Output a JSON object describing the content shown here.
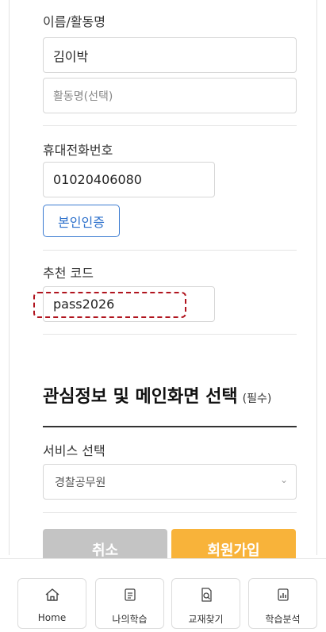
{
  "name_section": {
    "label": "이름/활동명",
    "name_value": "김이박",
    "nickname_placeholder": "활동명(선택)"
  },
  "phone_section": {
    "label": "휴대전화번호",
    "phone_value": "01020406080",
    "verify_label": "본인인증"
  },
  "referral_section": {
    "label": "추천 코드",
    "code_value": "pass2026"
  },
  "interest_section": {
    "title": "관심정보 및 메인화면 선택",
    "required": "(필수)",
    "service_label": "서비스 선택",
    "service_selected": "경찰공무원"
  },
  "actions": {
    "cancel_label": "취소",
    "join_label": "회원가입"
  },
  "tabbar": {
    "items": [
      {
        "label": "Home",
        "icon": "home-icon"
      },
      {
        "label": "나의학습",
        "icon": "my-study-icon"
      },
      {
        "label": "교재찾기",
        "icon": "book-search-icon"
      },
      {
        "label": "학습분석",
        "icon": "analysis-icon"
      }
    ]
  },
  "colors": {
    "verify_blue": "#2b6fcb",
    "join_orange": "#f8b33a",
    "cancel_gray": "#c4c4c4",
    "highlight_red": "#b0141e"
  }
}
